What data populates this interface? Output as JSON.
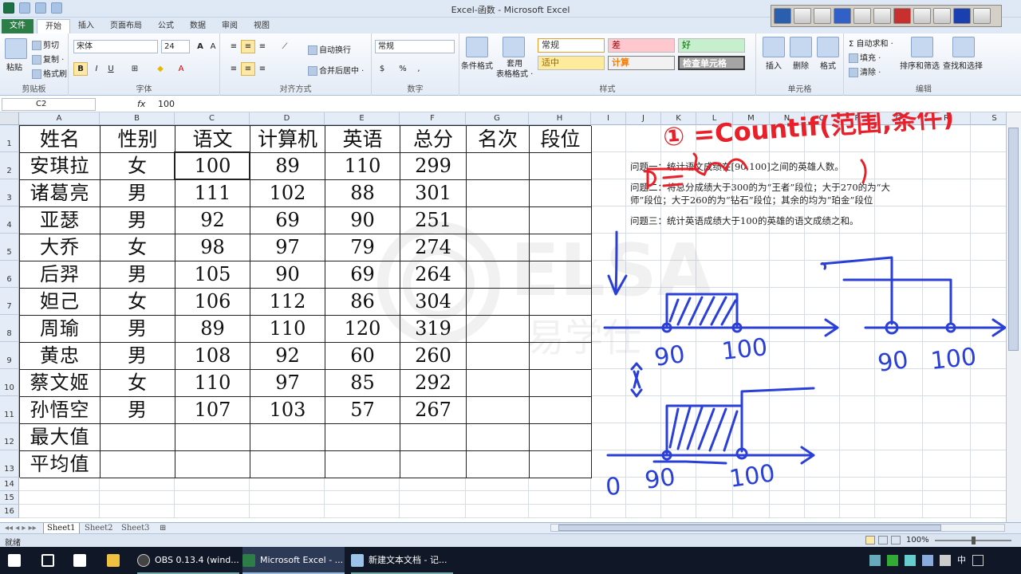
{
  "window": {
    "title": "Excel-函数 - Microsoft Excel"
  },
  "ribbon_tabs": [
    "文件",
    "开始",
    "插入",
    "页面布局",
    "公式",
    "数据",
    "审阅",
    "视图"
  ],
  "ribbon": {
    "clipboard": {
      "paste": "粘贴",
      "cut": "剪切",
      "copy": "复制 ·",
      "format_painter": "格式刷",
      "label": "剪贴板"
    },
    "font": {
      "name": "宋体",
      "size": "24",
      "label": "字体"
    },
    "alignment": {
      "wrap": "自动换行",
      "merge": "合并后居中 ·",
      "label": "对齐方式"
    },
    "number": {
      "format": "常规",
      "label": "数字"
    },
    "styles": {
      "cond": "条件格式",
      "table": "套用\n表格格式 ·",
      "s1": "常规",
      "s2": "差",
      "s3": "好",
      "s4": "适中",
      "s5": "计算",
      "s6": "检查单元格",
      "label": "样式"
    },
    "cells": {
      "insert": "插入",
      "delete": "删除",
      "format": "格式",
      "label": "单元格"
    },
    "editing": {
      "autosum": "自动求和 ·",
      "fill": "填充 ·",
      "clear": "清除 ·",
      "sort": "排序和筛选",
      "find": "查找和选择",
      "label": "编辑"
    }
  },
  "formula_bar": {
    "cell_ref": "C2",
    "fx": "fx",
    "value": "100"
  },
  "columns": [
    "A",
    "B",
    "C",
    "D",
    "E",
    "F",
    "G",
    "H",
    "I",
    "J",
    "K",
    "L",
    "M",
    "N",
    "O",
    "P",
    "Q",
    "R",
    "S"
  ],
  "rows": [
    "1",
    "2",
    "3",
    "4",
    "5",
    "6",
    "7",
    "8",
    "9",
    "10",
    "11",
    "12",
    "13",
    "14",
    "15",
    "16"
  ],
  "table": {
    "headers": [
      "姓名",
      "性别",
      "语文",
      "计算机",
      "英语",
      "总分",
      "名次",
      "段位"
    ],
    "rows": [
      [
        "安琪拉",
        "女",
        "100",
        "89",
        "110",
        "299",
        "",
        ""
      ],
      [
        "诸葛亮",
        "男",
        "111",
        "102",
        "88",
        "301",
        "",
        ""
      ],
      [
        "亚瑟",
        "男",
        "92",
        "69",
        "90",
        "251",
        "",
        ""
      ],
      [
        "大乔",
        "女",
        "98",
        "97",
        "79",
        "274",
        "",
        ""
      ],
      [
        "后羿",
        "男",
        "105",
        "90",
        "69",
        "264",
        "",
        ""
      ],
      [
        "妲己",
        "女",
        "106",
        "112",
        "86",
        "304",
        "",
        ""
      ],
      [
        "周瑜",
        "男",
        "89",
        "110",
        "120",
        "319",
        "",
        ""
      ],
      [
        "黄忠",
        "男",
        "108",
        "92",
        "60",
        "260",
        "",
        ""
      ],
      [
        "蔡文姬",
        "女",
        "110",
        "97",
        "85",
        "292",
        "",
        ""
      ],
      [
        "孙悟空",
        "男",
        "107",
        "103",
        "57",
        "267",
        "",
        ""
      ]
    ],
    "footer": [
      "最大值",
      "平均值"
    ]
  },
  "notes": {
    "q1": "问题一：统计语文成绩在[90,100]之间的英雄人数。",
    "q2a": "问题二：将总分成绩大于300的为“王者”段位；大于270的为“大",
    "q2b": "师”段位；大于260的为“钻石”段位；其余的均为“珀金”段位",
    "q3": "问题三：统计英语成绩大于100的英雄的语文成绩之和。"
  },
  "handwriting": {
    "formula": "① =Countif(范围,条件)",
    "n90": "90",
    "n100": "100",
    "n90b": "90",
    "n100b": "100",
    "n90c": "90",
    "n100c": "100",
    "circle": "0"
  },
  "watermark": {
    "brand": "ELSA",
    "cn": "易学仕"
  },
  "sheets": [
    "Sheet1",
    "Sheet2",
    "Sheet3"
  ],
  "status": {
    "ready": "就绪",
    "zoom": "100%"
  },
  "taskbar": {
    "items": [
      "OBS 0.13.4 (wind...",
      "Microsoft Excel - ...",
      "新建文本文档 - 记..."
    ],
    "ime": "中"
  },
  "colors": {
    "ink": "#2a3fd8",
    "red_ink": "#e8202a",
    "excel_green": "#2d7d46"
  }
}
